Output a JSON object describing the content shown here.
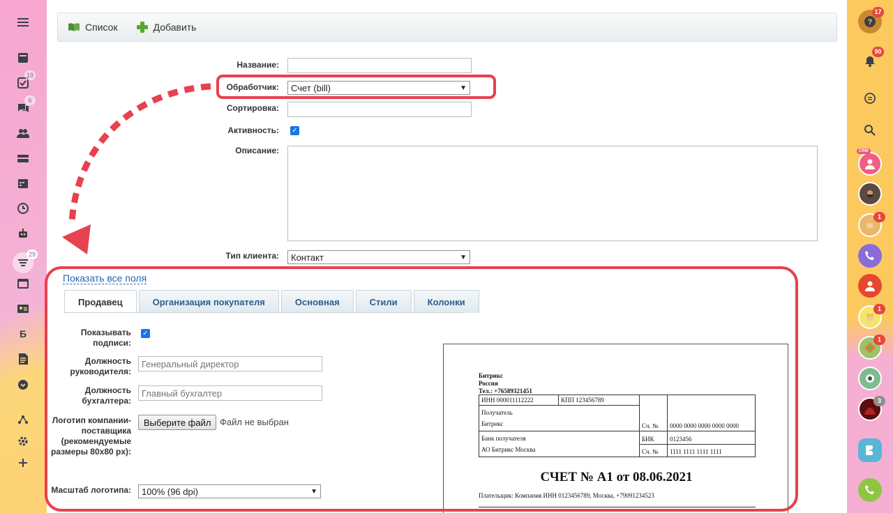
{
  "left_sidebar": {
    "badges": {
      "tasks": "19",
      "chat": "6",
      "filter": "29"
    },
    "letter_item": "Б"
  },
  "right_sidebar": {
    "badges": {
      "help": "17",
      "notifications": "90",
      "avatar_2": "1",
      "avatar_5": "1",
      "avatar_6": "1",
      "avatar_8": "3"
    },
    "crm_label": "CRM"
  },
  "toolbar": {
    "list_label": "Список",
    "add_label": "Добавить"
  },
  "form": {
    "name_label": "Название:",
    "name_value": "",
    "handler_label": "Обработчик:",
    "handler_value": "Счет (bill)",
    "sort_label": "Сортировка:",
    "sort_value": "",
    "active_label": "Активность:",
    "description_label": "Описание:",
    "client_type_label": "Тип клиента:",
    "client_type_value": "Контакт"
  },
  "show_all_fields": "Показать все поля",
  "tabs": [
    {
      "label": "Продавец",
      "active": true
    },
    {
      "label": "Организация покупателя",
      "active": false
    },
    {
      "label": "Основная",
      "active": false
    },
    {
      "label": "Стили",
      "active": false
    },
    {
      "label": "Колонки",
      "active": false
    }
  ],
  "seller": {
    "show_signatures_label": "Показывать подписи:",
    "director_position_label": "Должность руководителя:",
    "director_position_placeholder": "Генеральный директор",
    "accountant_position_label": "Должность бухгалтера:",
    "accountant_position_placeholder": "Главный бухгалтер",
    "logo_label": "Логотип компании-поставщика (рекомендуемые размеры 80x80 px):",
    "choose_file_button": "Выберите файл",
    "no_file_text": "Файл не выбран",
    "logo_scale_label": "Масштаб логотипа:",
    "logo_scale_value": "100% (96 dpi)"
  },
  "invoice": {
    "company": "Битрикс",
    "country": "Россия",
    "phone": "Тел.: +76589321451",
    "inn": "ИНН 000011112222",
    "kpp": "КПП 123456789",
    "recipient_label": "Получатель",
    "recipient_name": "Битрикс",
    "account_label": "Сч. №",
    "account_value": "0000 0000 0000 0000 0000",
    "bank_label": "Банк получателя",
    "bank_name": "АО Битрикс Москва",
    "bik_label": "БИК",
    "bik_value": "0123456",
    "corr_account_label": "Сч. №",
    "corr_account_value": "1111 1111 1111 1111",
    "title": "СЧЕТ № А1 от 08.06.2021",
    "payer": "Плательщик: Компания ИНН 0123456789, Москва, +79091234523"
  },
  "colors": {
    "annotation_red": "#e8414f",
    "link_blue": "#2067b0",
    "checkbox_blue": "#1a73e8"
  }
}
